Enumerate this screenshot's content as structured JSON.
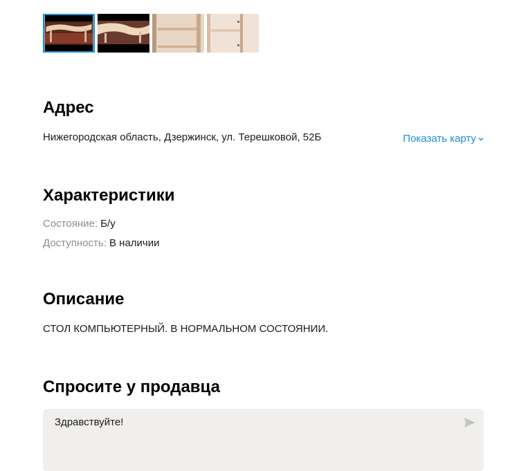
{
  "gallery": {
    "thumbnails": [
      {
        "icon": "table-photo-1",
        "active": true
      },
      {
        "icon": "table-photo-2",
        "active": false
      },
      {
        "icon": "table-photo-3",
        "active": false
      },
      {
        "icon": "table-photo-4",
        "active": false
      }
    ],
    "active_color": "#1a8fd6"
  },
  "address": {
    "title": "Адрес",
    "value": "Нижегородская область, Дзержинск, ул. Терешковой, 52Б",
    "show_map_label": "Показать карту"
  },
  "characteristics": {
    "title": "Характеристики",
    "condition_label": "Состояние:",
    "condition_value": "Б/у",
    "availability_label": "Доступность:",
    "availability_value": "В наличии"
  },
  "description": {
    "title": "Описание",
    "text": "СТОЛ КОМПЬЮТЕРНЫЙ. В НОРМАЛЬНОМ СОСТОЯНИИ."
  },
  "ask_seller": {
    "title": "Спросите у продавца",
    "message_value": "Здравствуйте!",
    "send_icon": "send-icon"
  },
  "colors": {
    "link": "#1a8fd6",
    "muted": "#8c8c8c",
    "input_bg": "#f0efed"
  }
}
